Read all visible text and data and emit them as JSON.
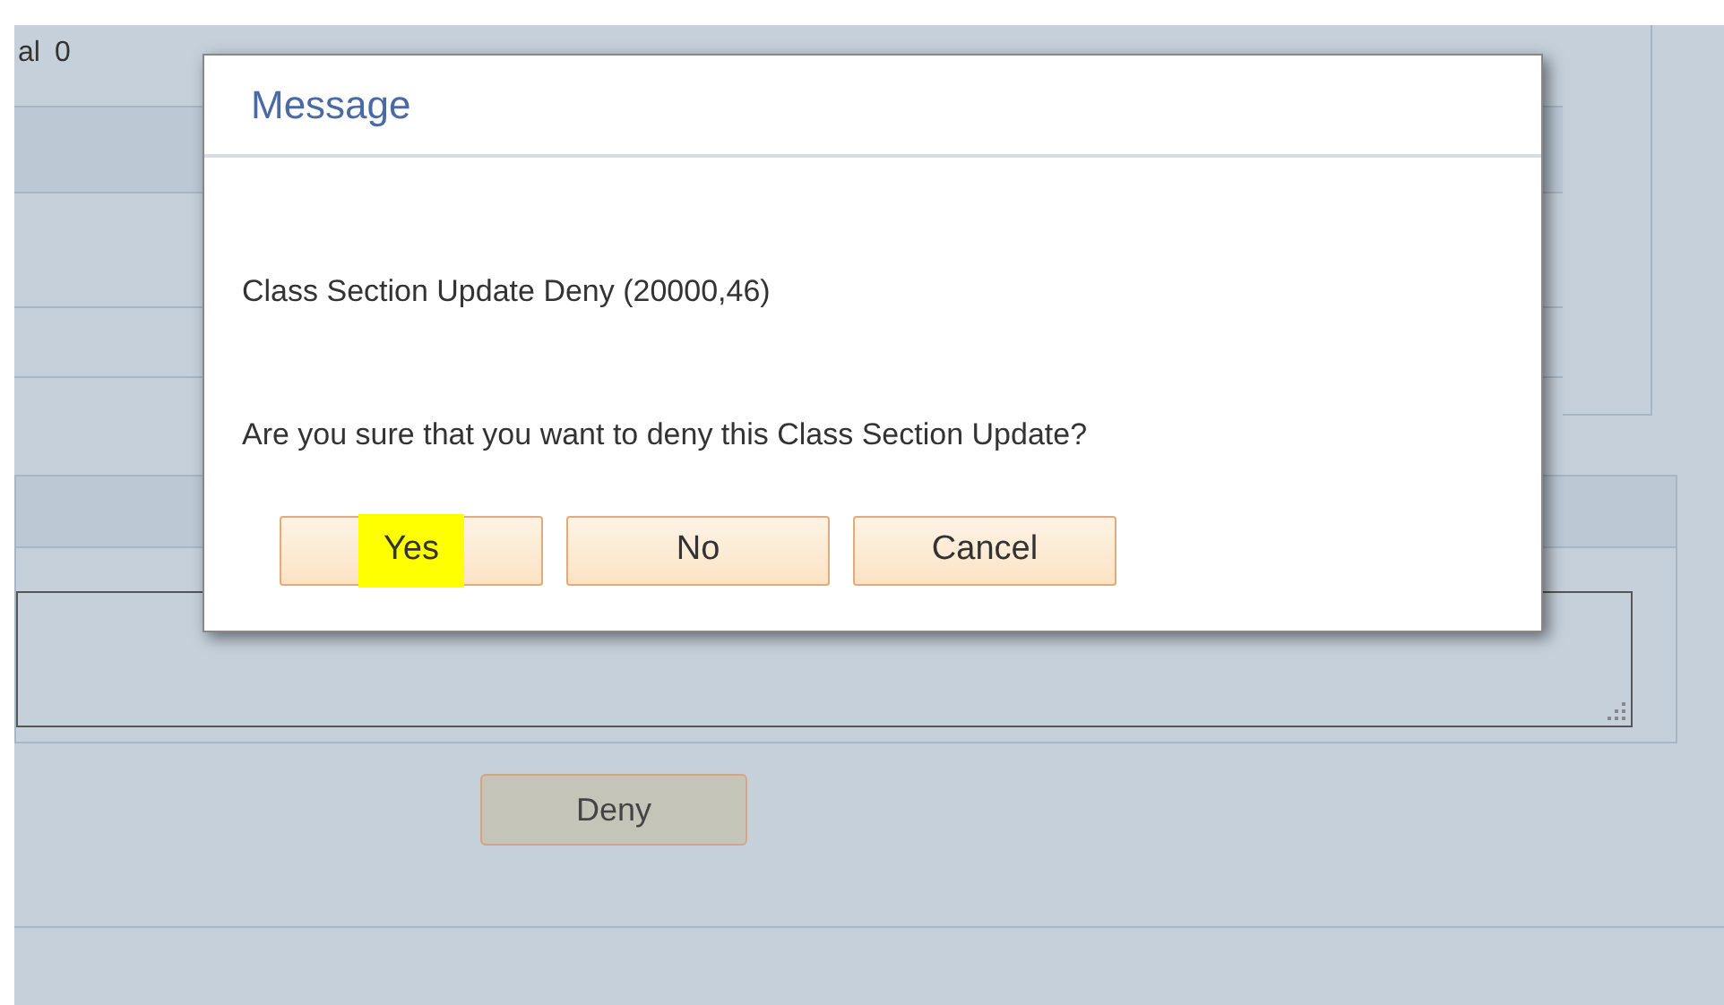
{
  "page": {
    "total_label": "al",
    "total_value": "0",
    "action_button": "Deny"
  },
  "dialog": {
    "title": "Message",
    "lines": [
      "Class Section Update Deny (20000,46)",
      "Are you sure that you want to deny this Class Section Update?"
    ],
    "buttons": [
      {
        "label": "Yes",
        "highlighted": true
      },
      {
        "label": "No",
        "highlighted": false
      },
      {
        "label": "Cancel",
        "highlighted": false
      }
    ]
  }
}
